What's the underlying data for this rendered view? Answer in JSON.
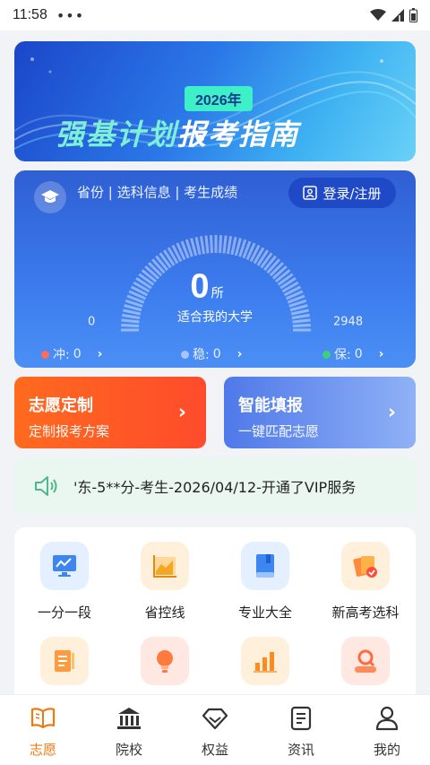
{
  "status_bar": {
    "time": "11:58",
    "dots": "•••"
  },
  "banner": {
    "year": "2026年",
    "title_part1": "强基计划",
    "title_part2": "报考指南",
    "page_count": 2,
    "active_page": 1
  },
  "score_card": {
    "info": "省份 | 选科信息 | 考生成绩",
    "login_label": "登录/注册",
    "count": "0",
    "count_unit": "所",
    "count_label": "适合我的大学",
    "range_min": "0",
    "range_max": "2948",
    "stats": {
      "chong": {
        "label": "冲:",
        "value": "0",
        "color": "#ff6b5b"
      },
      "wen": {
        "label": "稳:",
        "value": "0",
        "color": "#a8c3ff"
      },
      "bao": {
        "label": "保:",
        "value": "0",
        "color": "#3ecf7a"
      }
    }
  },
  "features": [
    {
      "title": "志愿定制",
      "subtitle": "定制报考方案"
    },
    {
      "title": "智能填报",
      "subtitle": "一键匹配志愿"
    }
  ],
  "notice": {
    "text": "'东-5**分-考生-2026/04/12-开通了VIP服务"
  },
  "tools": [
    {
      "label": "一分一段",
      "icon": "monitor-chart-icon"
    },
    {
      "label": "省控线",
      "icon": "line-chart-icon"
    },
    {
      "label": "专业大全",
      "icon": "book-icon"
    },
    {
      "label": "新高考选科",
      "icon": "cards-check-icon"
    },
    {
      "label": "",
      "icon": "notebook-icon"
    },
    {
      "label": "",
      "icon": "lightbulb-icon"
    },
    {
      "label": "",
      "icon": "bar-chart-icon"
    },
    {
      "label": "",
      "icon": "search-person-icon"
    }
  ],
  "tabbar": [
    {
      "label": "志愿",
      "icon": "book-open-icon",
      "active": true
    },
    {
      "label": "院校",
      "icon": "building-icon",
      "active": false
    },
    {
      "label": "权益",
      "icon": "diamond-icon",
      "active": false
    },
    {
      "label": "资讯",
      "icon": "document-icon",
      "active": false
    },
    {
      "label": "我的",
      "icon": "user-icon",
      "active": false
    }
  ],
  "colors": {
    "accent": "#f07a12",
    "primary": "#2f63d8"
  }
}
